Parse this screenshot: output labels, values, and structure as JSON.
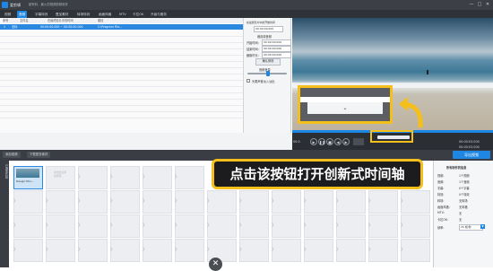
{
  "app": {
    "title": "爱剪辑",
    "subtitle": "超有料，最火的视频剪辑软件",
    "window_controls": [
      "—",
      "□",
      "✕"
    ]
  },
  "tabs": [
    {
      "label": "视频",
      "active": false
    },
    {
      "label": "音频",
      "active": true
    },
    {
      "label": "字幕特效",
      "active": false
    },
    {
      "label": "叠加素材",
      "active": false
    },
    {
      "label": "转场特效",
      "active": false
    },
    {
      "label": "画面风格",
      "active": false
    },
    {
      "label": "MTV",
      "active": false
    },
    {
      "label": "卡拉OK",
      "active": false
    },
    {
      "label": "升级与服务",
      "active": false
    }
  ],
  "audio_list": {
    "columns": [
      "序号",
      "文件名",
      "在最终影片中的时间",
      "路径"
    ],
    "rows": [
      {
        "index": "1",
        "name": "无标",
        "time": "00:00:00.000 ~ 00:00:00.000",
        "path": "C:\\Program File..."
      }
    ]
  },
  "audio_settings": {
    "section_title": "在最终影片中的开始时间",
    "start_time": "00:00:00.000",
    "trim_title": "裁剪原音频",
    "trim_start_label": "开始时间:",
    "trim_start": "00:00:00.000",
    "trim_end_label": "结束时间:",
    "trim_end": "00:00:00.000",
    "trim_duration_label": "截取时长:",
    "trim_duration": "00:00:00.000",
    "confirm_button": "确认修改",
    "volume_title": "音频音量",
    "fade_label": "头尾声音淡入淡出"
  },
  "player": {
    "current_time": "00:00:03.000",
    "total_time": "00:00:03.000",
    "left_time": "00:0",
    "right_time_top": "00:00:03.000",
    "right_time_bottom": "00:00:03.000"
  },
  "bottom_toolbar": {
    "add_button": "添加视频",
    "tip_button": "下载更多素材",
    "export_button": "导出视频"
  },
  "timeline": {
    "section_label": "已添加片段",
    "clip_label": "Design Min...",
    "empty_tip": "双击此处添加视频"
  },
  "properties": {
    "title": "所有制作的信息",
    "rows": [
      {
        "k": "视频:",
        "v": "1个视频"
      },
      {
        "k": "音频:",
        "v": "1个音频"
      },
      {
        "k": "字幕:",
        "v": "0个字幕"
      },
      {
        "k": "特效:",
        "v": "0个特效"
      },
      {
        "k": "转场:",
        "v": "无转场"
      },
      {
        "k": "画面风格:",
        "v": "无风格"
      },
      {
        "k": "MTV:",
        "v": "无"
      },
      {
        "k": "卡拉OK:",
        "v": "无"
      }
    ],
    "speed_label": "帧率:",
    "speed_value": "25 帧/秒"
  },
  "callout": {
    "text": "点击该按钮打开创新式时间轴"
  },
  "colors": {
    "accent": "#1e87e4",
    "highlight": "#f5bf1b",
    "dark": "#2b2e33"
  }
}
